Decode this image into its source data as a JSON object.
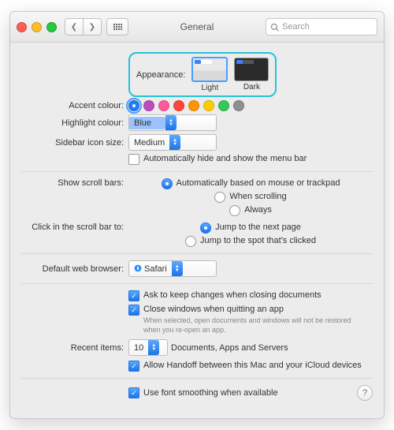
{
  "window": {
    "title": "General"
  },
  "search": {
    "placeholder": "Search"
  },
  "appearance": {
    "label": "Appearance:",
    "light": "Light",
    "dark": "Dark"
  },
  "accent": {
    "label": "Accent colour:",
    "colors": [
      "#1e7cff",
      "#bf4bbf",
      "#ff5a9e",
      "#ff453a",
      "#ff9500",
      "#ffcc00",
      "#34c759",
      "#8e8e93"
    ]
  },
  "highlight": {
    "label": "Highlight colour:",
    "value": "Blue"
  },
  "sidebar": {
    "label": "Sidebar icon size:",
    "value": "Medium"
  },
  "menubar": {
    "label": "Automatically hide and show the menu bar"
  },
  "scrollbars": {
    "label": "Show scroll bars:",
    "opts": [
      "Automatically based on mouse or trackpad",
      "When scrolling",
      "Always"
    ]
  },
  "scrollclick": {
    "label": "Click in the scroll bar to:",
    "opts": [
      "Jump to the next page",
      "Jump to the spot that's clicked"
    ]
  },
  "browser": {
    "label": "Default web browser:",
    "value": "Safari"
  },
  "ask": {
    "label": "Ask to keep changes when closing documents"
  },
  "close": {
    "label": "Close windows when quitting an app",
    "hint": "When selected, open documents and windows will not be restored when you re-open an app."
  },
  "recent": {
    "label": "Recent items:",
    "value": "10",
    "suffix": "Documents, Apps and Servers"
  },
  "handoff": {
    "label": "Allow Handoff between this Mac and your iCloud devices"
  },
  "fontsmoothing": {
    "label": "Use font smoothing when available"
  }
}
